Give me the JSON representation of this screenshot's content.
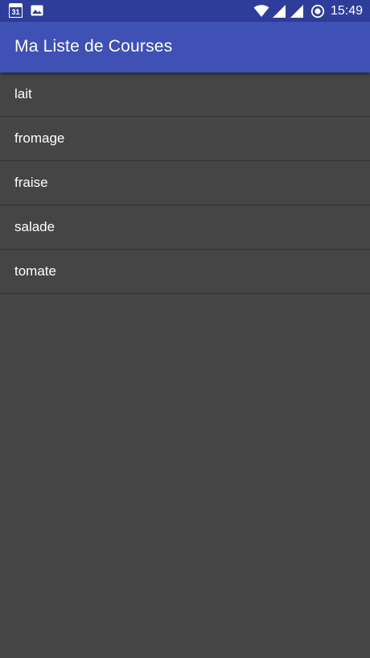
{
  "status_bar": {
    "calendar_day": "31",
    "time": "15:49",
    "left_icons": [
      "calendar-icon",
      "image-icon"
    ],
    "right_icons": [
      "wifi-icon",
      "signal-icon",
      "signal-icon-2",
      "sync-icon"
    ]
  },
  "app_bar": {
    "title": "Ma Liste de Courses",
    "color": "#3f51b5"
  },
  "list": {
    "items": [
      {
        "label": "lait"
      },
      {
        "label": "fromage"
      },
      {
        "label": "fraise"
      },
      {
        "label": "salade"
      },
      {
        "label": "tomate"
      }
    ]
  },
  "colors": {
    "status_bar": "#2f3d9a",
    "background": "#454545",
    "divider": "#333333",
    "text": "#ffffff"
  }
}
